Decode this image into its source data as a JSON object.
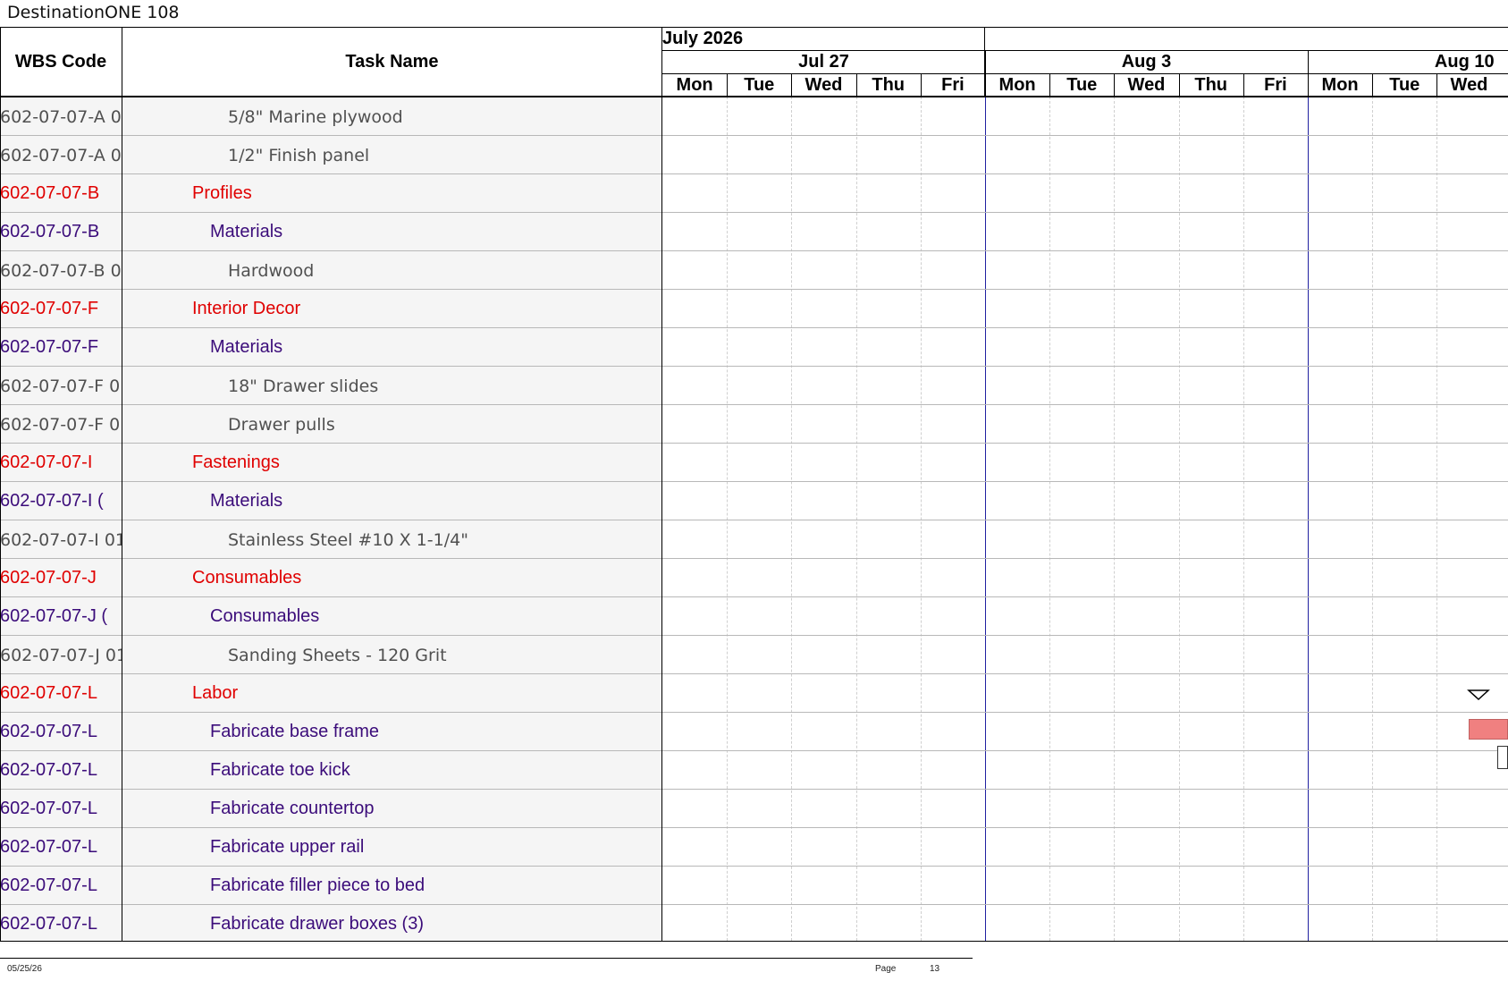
{
  "document": {
    "title": "DestinationONE 108"
  },
  "columns": {
    "wbs": "WBS Code",
    "task": "Task Name"
  },
  "timescale": {
    "month": "July 2026",
    "weeks": [
      "Jul 27",
      "Aug 3",
      "Aug 10"
    ],
    "days": [
      "Mon",
      "Tue",
      "Wed",
      "Thu",
      "Fri",
      "Mon",
      "Tue",
      "Wed",
      "Thu",
      "Fri",
      "Mon",
      "Tue",
      "Wed"
    ]
  },
  "rows": [
    {
      "wbs": "602-07-07-A 0",
      "task": "5/8\" Marine plywood",
      "level": 3
    },
    {
      "wbs": "602-07-07-A 0",
      "task": "1/2\" Finish panel",
      "level": 3
    },
    {
      "wbs": "602-07-07-B",
      "task": "Profiles",
      "level": 1
    },
    {
      "wbs": "602-07-07-B",
      "task": "Materials",
      "level": 2
    },
    {
      "wbs": "602-07-07-B 0",
      "task": "Hardwood",
      "level": 3
    },
    {
      "wbs": "602-07-07-F",
      "task": "Interior Decor",
      "level": 1
    },
    {
      "wbs": "602-07-07-F",
      "task": "Materials",
      "level": 2
    },
    {
      "wbs": "602-07-07-F 0",
      "task": "18\" Drawer slides",
      "level": 3
    },
    {
      "wbs": "602-07-07-F 0",
      "task": "Drawer pulls",
      "level": 3
    },
    {
      "wbs": "602-07-07-I",
      "task": "Fastenings",
      "level": 1
    },
    {
      "wbs": "602-07-07-I (",
      "task": "Materials",
      "level": 2
    },
    {
      "wbs": "602-07-07-I 01",
      "task": "Stainless Steel #10 X 1-1/4\"",
      "level": 3
    },
    {
      "wbs": "602-07-07-J",
      "task": "Consumables",
      "level": 1
    },
    {
      "wbs": "602-07-07-J (",
      "task": "Consumables",
      "level": 2
    },
    {
      "wbs": "602-07-07-J 01",
      "task": "Sanding Sheets - 120 Grit",
      "level": 3
    },
    {
      "wbs": "602-07-07-L",
      "task": "Labor",
      "level": 1
    },
    {
      "wbs": "602-07-07-L",
      "task": "Fabricate base frame",
      "level": 2
    },
    {
      "wbs": "602-07-07-L",
      "task": "Fabricate toe kick",
      "level": 2
    },
    {
      "wbs": "602-07-07-L",
      "task": "Fabricate countertop",
      "level": 2
    },
    {
      "wbs": "602-07-07-L",
      "task": "Fabricate upper rail",
      "level": 2
    },
    {
      "wbs": "602-07-07-L",
      "task": "Fabricate filler piece to bed",
      "level": 2
    },
    {
      "wbs": "602-07-07-L",
      "task": "Fabricate drawer boxes (3)",
      "level": 2
    }
  ],
  "footer": {
    "date": "05/25/26",
    "page_label": "Page",
    "page_number": "13"
  },
  "colors": {
    "level1": "#e00000",
    "level2": "#3b0c7a",
    "level3": "#505050",
    "task_bar": "#f08080",
    "week_divider": "#2020a0"
  }
}
